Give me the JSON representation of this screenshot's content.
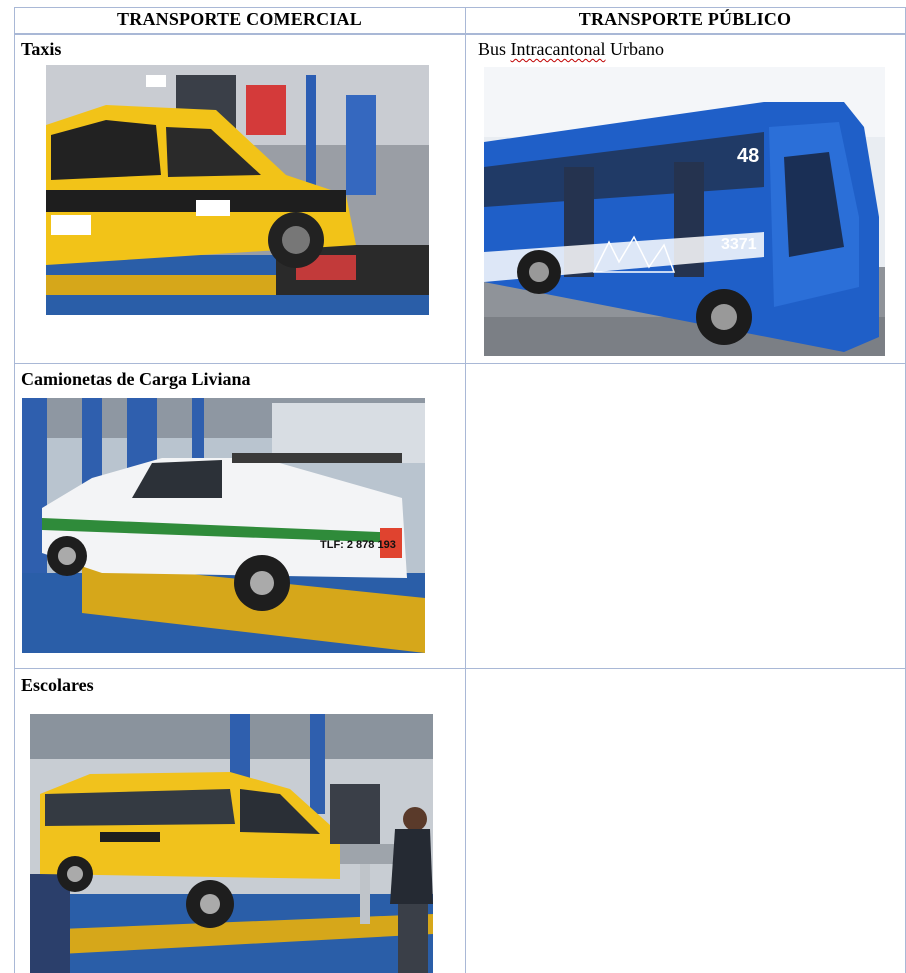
{
  "table": {
    "headers": [
      "TRANSPORTE COMERCIAL",
      "TRANSPORTE PÚBLICO"
    ],
    "rows": [
      {
        "left_label": "Taxis",
        "left_image": "taxi-inspection-photo",
        "right_label_prefix": "Bus ",
        "right_label_marked": "Intracantonal",
        "right_label_suffix": " Urbano",
        "right_image": "blue-city-bus-photo",
        "bus_number": "3371",
        "bus_route": "48"
      },
      {
        "left_label": "Camionetas de Carga Liviana",
        "left_image": "pickup-truck-inspection-photo",
        "truck_phone": "TLF: 2 878 193"
      },
      {
        "left_label": "Escolares",
        "left_image": "school-van-inspection-photo"
      }
    ]
  },
  "colors": {
    "grid": "#a9b8d6",
    "taxi_yellow": "#f2c318",
    "bus_blue": "#1f5fc8",
    "floor_blue": "#2a5ea8",
    "spellcheck": "#c00000"
  }
}
